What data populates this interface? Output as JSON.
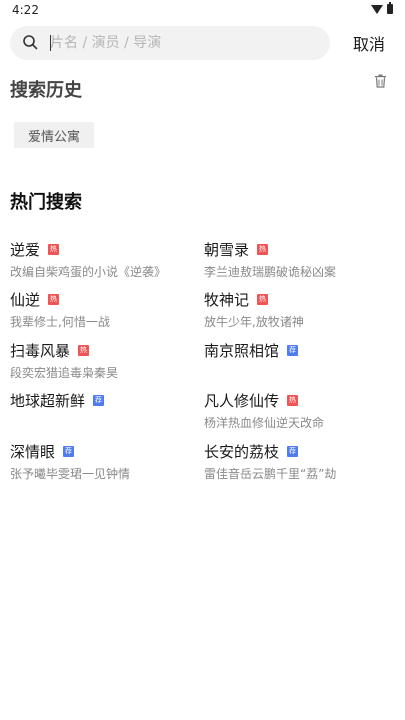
{
  "status_bar": {
    "time": "4:22"
  },
  "search": {
    "placeholder": "片名 / 演员 / 导演",
    "cancel_label": "取消"
  },
  "history": {
    "title": "搜索历史",
    "items": [
      "爱情公寓"
    ]
  },
  "hot": {
    "title": "热门搜索",
    "items": [
      {
        "name": "逆爱",
        "badge": "热",
        "desc": "改编自柴鸡蛋的小说《逆袭》"
      },
      {
        "name": "朝雪录",
        "badge": "热",
        "desc": "李兰迪敖瑞鹏破诡秘凶案"
      },
      {
        "name": "仙逆",
        "badge": "热",
        "desc": "我辈修士,何惜一战"
      },
      {
        "name": "牧神记",
        "badge": "热",
        "desc": "放牛少年,放牧诸神"
      },
      {
        "name": "扫毒风暴",
        "badge": "热",
        "desc": "段奕宏猎追毒枭秦昊"
      },
      {
        "name": "南京照相馆",
        "badge": "荐",
        "desc": ""
      },
      {
        "name": "地球超新鲜",
        "badge": "荐",
        "desc": ""
      },
      {
        "name": "凡人修仙传",
        "badge": "热",
        "desc": "杨洋热血修仙逆天改命"
      },
      {
        "name": "深情眼",
        "badge": "荐",
        "desc": "张予曦毕雯珺一见钟情"
      },
      {
        "name": "长安的荔枝",
        "badge": "荐",
        "desc": "雷佳音岳云鹏千里“荔”劫"
      }
    ]
  },
  "colors": {
    "hot_badge": "#f05555",
    "recommend_badge": "#4f7cf0"
  }
}
